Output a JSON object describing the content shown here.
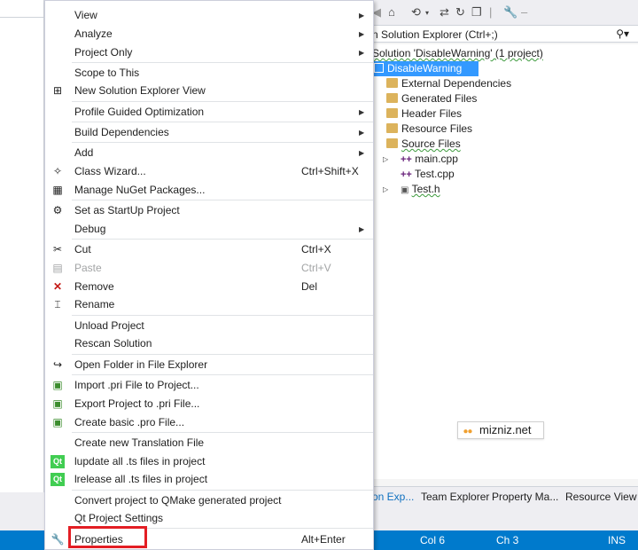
{
  "context_menu": {
    "items": [
      {
        "label": "View",
        "submenu": true
      },
      {
        "label": "Analyze",
        "submenu": true
      },
      {
        "label": "Project Only",
        "submenu": true
      },
      {
        "label": "Scope to This"
      },
      {
        "label": "New Solution Explorer View",
        "icon": "new-explorer-view-icon"
      },
      {
        "label": "Profile Guided Optimization",
        "submenu": true
      },
      {
        "label": "Build Dependencies",
        "submenu": true
      },
      {
        "label": "Add",
        "submenu": true
      },
      {
        "label": "Class Wizard...",
        "shortcut": "Ctrl+Shift+X",
        "icon": "class-wizard-icon"
      },
      {
        "label": "Manage NuGet Packages...",
        "icon": "nuget-icon"
      },
      {
        "label": "Set as StartUp Project",
        "icon": "gear-icon"
      },
      {
        "label": "Debug",
        "submenu": true
      },
      {
        "label": "Cut",
        "shortcut": "Ctrl+X",
        "icon": "scissors-icon"
      },
      {
        "label": "Paste",
        "shortcut": "Ctrl+V",
        "icon": "paste-icon",
        "disabled": true
      },
      {
        "label": "Remove",
        "shortcut": "Del",
        "icon": "remove-x-icon"
      },
      {
        "label": "Rename",
        "icon": "rename-icon"
      },
      {
        "label": "Unload Project"
      },
      {
        "label": "Rescan Solution"
      },
      {
        "label": "Open Folder in File Explorer",
        "icon": "open-folder-arrow-icon"
      },
      {
        "label": "Import .pri File to Project...",
        "icon": "import-pri-icon"
      },
      {
        "label": "Export Project to .pri File...",
        "icon": "export-pri-icon"
      },
      {
        "label": "Create basic .pro File...",
        "icon": "create-pro-icon"
      },
      {
        "label": "Create new Translation File"
      },
      {
        "label": "lupdate all .ts files in project",
        "icon": "qt-icon"
      },
      {
        "label": "lrelease all .ts files in project",
        "icon": "qt-icon"
      },
      {
        "label": "Convert project to QMake generated project"
      },
      {
        "label": "Qt Project Settings"
      },
      {
        "label": "Properties",
        "shortcut": "Alt+Enter",
        "icon": "wrench-icon"
      }
    ]
  },
  "solution_explorer": {
    "search_placeholder": "n Solution Explorer (Ctrl+;)",
    "solution_label": "Solution 'DisableWarning' (1 project)",
    "project_label": "DisableWarning",
    "folders": [
      "External Dependencies",
      "Generated Files",
      "Header Files",
      "Resource Files",
      "Source Files"
    ],
    "files": [
      "main.cpp",
      "Test.cpp",
      "Test.h"
    ],
    "tabs": [
      "on Exp...",
      "Team Explorer",
      "Property Ma...",
      "Resource View"
    ]
  },
  "watermark": "mizniz.net",
  "status_bar": {
    "col": "Col 6",
    "ch": "Ch 3",
    "mode": "INS"
  },
  "colors": {
    "status_bar": "#007acc",
    "selection": "#3399ff",
    "highlight_box": "#e31e24"
  }
}
